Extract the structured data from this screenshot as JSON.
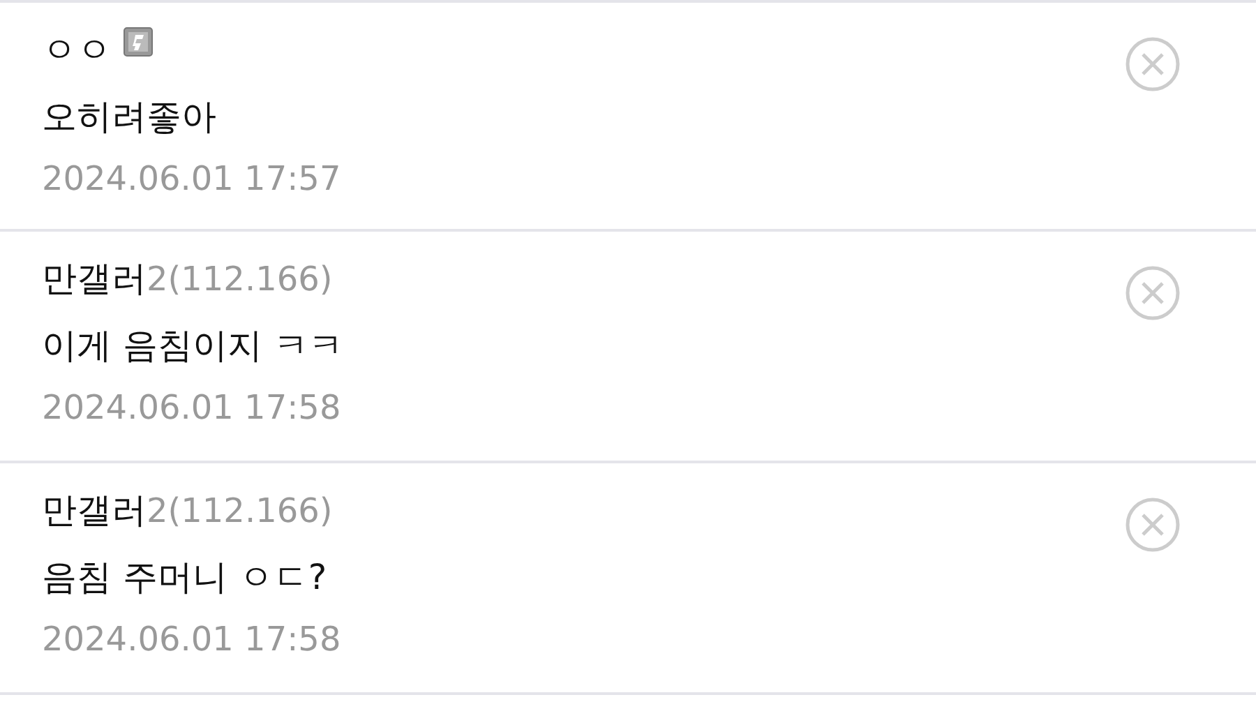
{
  "comments": [
    {
      "author": "ㅇㅇ",
      "member_icon": true,
      "text": "오히려좋아",
      "date": "2024.06.01 17:57"
    },
    {
      "author": "만갤러",
      "ip": "2(112.166)",
      "member_icon": false,
      "text": "이게 음침이지 ㅋㅋ",
      "date": "2024.06.01 17:58"
    },
    {
      "author": "만갤러",
      "ip": "2(112.166)",
      "member_icon": false,
      "text": "음침 주머니 ㅇㄷ?",
      "date": "2024.06.01 17:58"
    }
  ]
}
